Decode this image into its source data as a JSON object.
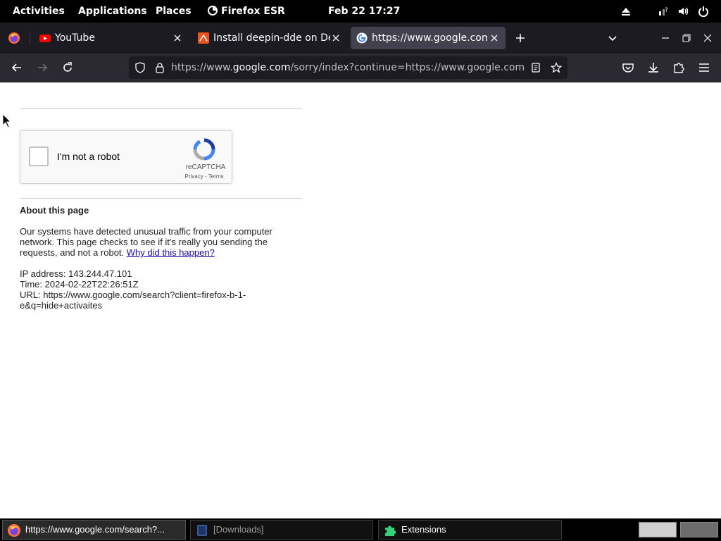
{
  "topbar": {
    "activities": "Activities",
    "applications": "Applications",
    "places": "Places",
    "app_name": "Firefox ESR",
    "clock": "Feb 22  17:27"
  },
  "tabs": [
    {
      "title": "YouTube",
      "favicon": "youtube-icon"
    },
    {
      "title": "Install deepin-dde on Del",
      "favicon": "ubuntu-icon"
    },
    {
      "title": "https://www.google.com/",
      "favicon": "google-icon"
    }
  ],
  "navbar": {
    "url_prefix": "https://www.",
    "url_host": "google.com",
    "url_rest": "/sorry/index?continue=https://www.google.com/search"
  },
  "captcha": {
    "label": "I'm not a robot",
    "brand": "reCAPTCHA",
    "links": "Privacy - Terms"
  },
  "about": {
    "title": "About this page",
    "message_lines": [
      "Our systems have detected unusual traffic from your computer",
      "network. This page checks to see if it's really you sending the"
    ],
    "message_last": "requests, and not a robot.",
    "why_link": "Why did this happen?",
    "ip": "IP address: 143.244.47.101",
    "time": "Time: 2024-02-22T22:26:51Z",
    "url_line1": "URL: https://www.google.com/search?client=firefox-b-1-",
    "url_line2": "e&q=hide+activaites"
  },
  "taskbar": [
    {
      "label": "https://www.google.com/search?...",
      "icon": "firefox-icon"
    },
    {
      "label": "[Downloads]",
      "icon": "files-icon"
    },
    {
      "label": "Extensions",
      "icon": "extensions-icon"
    }
  ],
  "colors": {
    "link": "#1a0dab",
    "tab_active": "#42414d",
    "toolbar": "#2b2a33"
  }
}
